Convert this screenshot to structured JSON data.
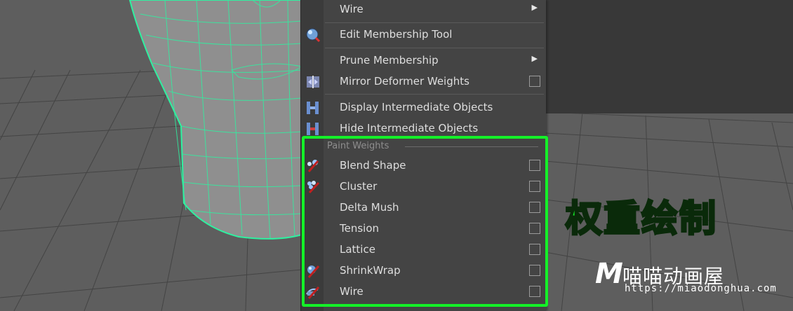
{
  "menu": {
    "top_items": [
      {
        "label": "Wire",
        "has_submenu": true,
        "icon": "none"
      },
      {
        "label": "Edit Membership Tool",
        "icon": "membership-tool-icon"
      },
      {
        "label": "Prune Membership",
        "has_submenu": true,
        "icon": "none"
      },
      {
        "label": "Mirror Deformer Weights",
        "has_option_box": true,
        "icon": "mirror-weights-icon"
      },
      {
        "label": "Display Intermediate Objects",
        "icon": "display-intermediate-icon"
      },
      {
        "label": "Hide Intermediate Objects",
        "icon": "hide-intermediate-icon"
      }
    ],
    "paint_weights_header": "Paint Weights",
    "paint_weights_items": [
      {
        "label": "Blend Shape",
        "icon": "paint-brush-icon"
      },
      {
        "label": "Cluster",
        "icon": "paint-brush-icon"
      },
      {
        "label": "Delta Mush",
        "icon": "none"
      },
      {
        "label": "Tension",
        "icon": "none"
      },
      {
        "label": "Lattice",
        "icon": "none"
      },
      {
        "label": "ShrinkWrap",
        "icon": "paint-brush-icon"
      },
      {
        "label": "Wire",
        "icon": "paint-brush-icon"
      }
    ]
  },
  "annotation": {
    "text": "权重绘制",
    "color": "#14f028"
  },
  "watermark": {
    "logo_letter": "M",
    "name": "喵喵动画屋",
    "url": "https://miaodonghua.com"
  },
  "colors": {
    "menu_bg": "#444444",
    "highlight": "#14f028",
    "wireframe": "#2ff0a0",
    "grid_bg": "#5d5d5d"
  }
}
